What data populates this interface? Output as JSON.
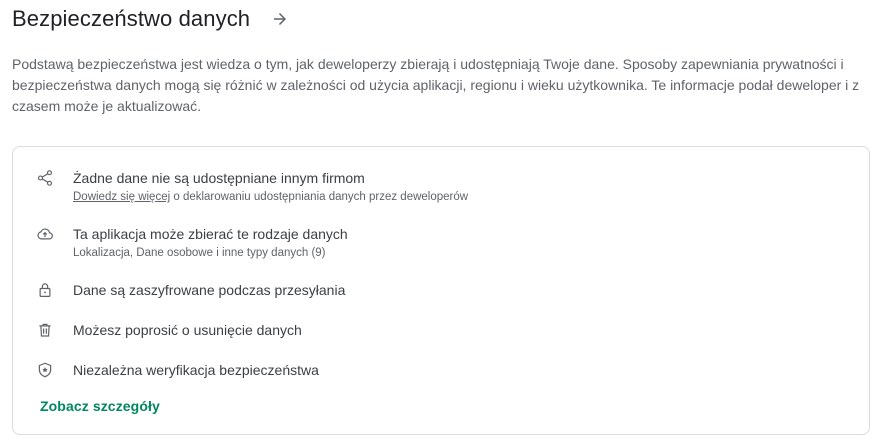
{
  "section": {
    "title": "Bezpieczeństwo danych",
    "arrow_icon": "arrow-forward-icon",
    "description": "Podstawą bezpieczeństwa jest wiedza o tym, jak deweloperzy zbierają i udostępniają Twoje dane. Sposoby zapewniania prywatności i bezpieczeństwa danych mogą się różnić w zależności od użycia aplikacji, regionu i wieku użytkownika. Te informacje podał deweloper i z czasem może je aktualizować."
  },
  "card": {
    "items": [
      {
        "icon": "share-icon",
        "primary": "Żadne dane nie są udostępniane innym firmom",
        "link": "Dowiedz się więcej",
        "secondary": " o deklarowaniu udostępniania danych przez deweloperów"
      },
      {
        "icon": "cloud-upload-icon",
        "primary": "Ta aplikacja może zbierać te rodzaje danych",
        "secondary": "Lokalizacja, Dane osobowe i inne typy danych (9)"
      },
      {
        "icon": "lock-icon",
        "primary": "Dane są zaszyfrowane podczas przesyłania"
      },
      {
        "icon": "trash-icon",
        "primary": "Możesz poprosić o usunięcie danych"
      },
      {
        "icon": "verified-shield-icon",
        "primary": "Niezależna weryfikacja bezpieczeństwa"
      }
    ],
    "details_link": "Zobacz szczegóły",
    "accent_color": "#01875f"
  }
}
